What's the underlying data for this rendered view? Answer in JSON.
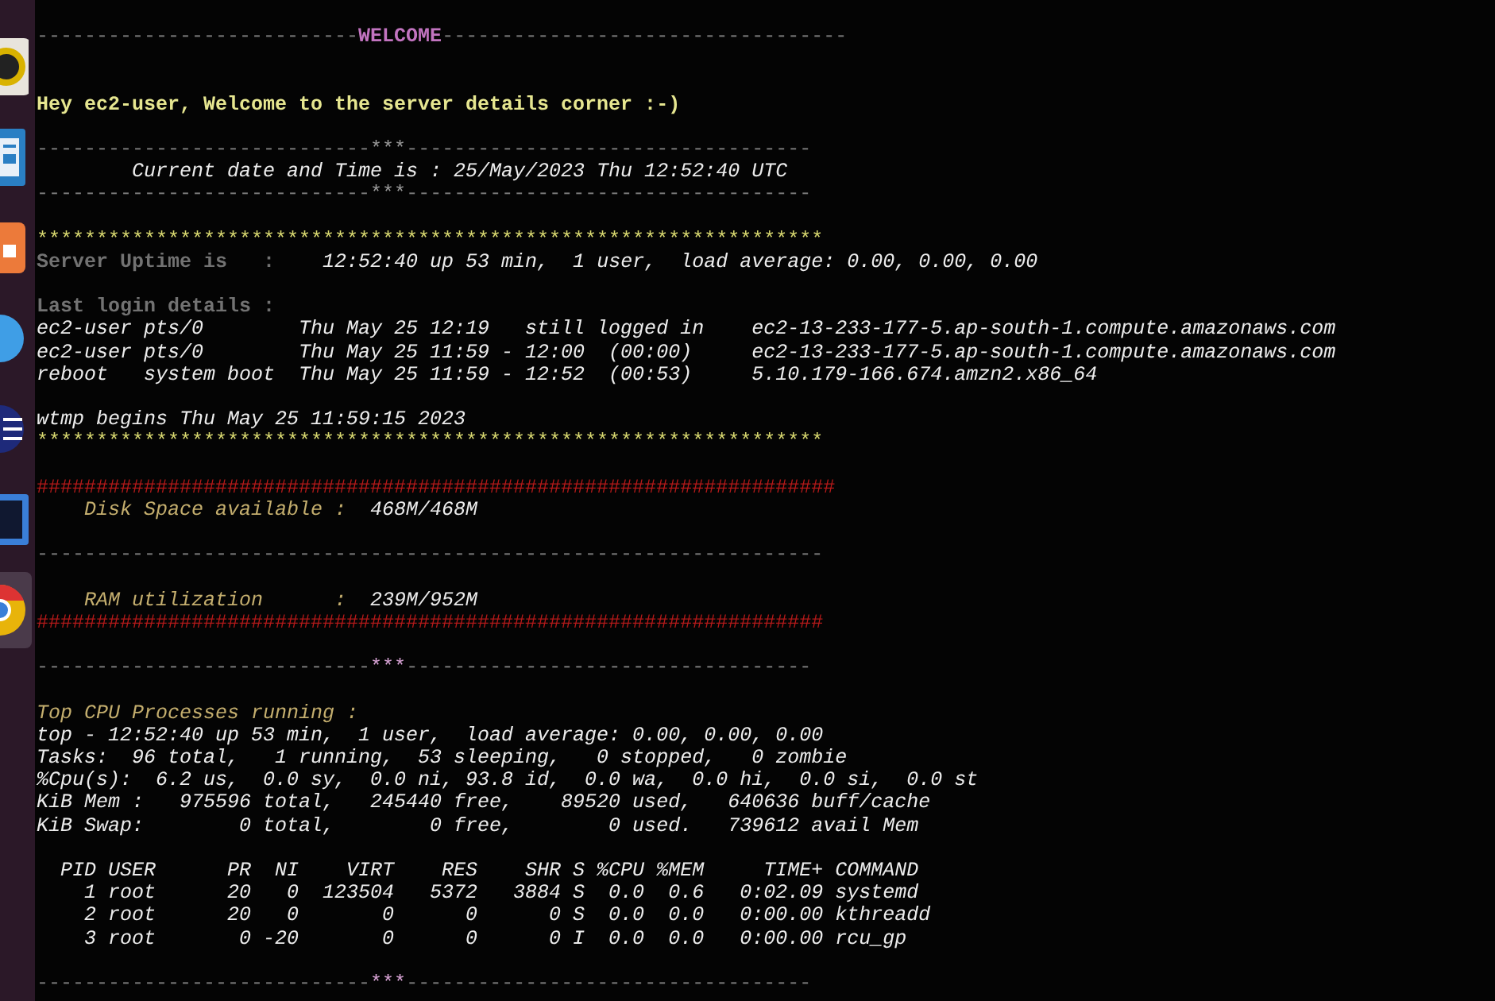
{
  "dock": {
    "items": [
      {
        "kind": "disc",
        "selected": false
      },
      {
        "kind": "document",
        "selected": false
      },
      {
        "kind": "tile",
        "selected": false
      },
      {
        "kind": "sphere",
        "selected": false
      },
      {
        "kind": "lines",
        "selected": false
      },
      {
        "kind": "window",
        "selected": false
      },
      {
        "kind": "browser",
        "selected": true
      }
    ]
  },
  "terminal": {
    "lines": [
      {
        "kind": "text",
        "spans": [
          {
            "text": "---------------------------",
            "kind": "dash"
          },
          {
            "text": "WELCOME",
            "kind": "magenta"
          },
          {
            "text": "----------------------------------",
            "kind": "dash"
          }
        ]
      },
      {
        "kind": "blank"
      },
      {
        "kind": "blank"
      },
      {
        "kind": "text",
        "spans": [
          {
            "text": "Hey ec2-user, Welcome to the server details corner :-)",
            "kind": "yellow"
          }
        ]
      },
      {
        "kind": "blank"
      },
      {
        "kind": "text",
        "spans": [
          {
            "text": "----------------------------",
            "kind": "dash"
          },
          {
            "text": "***",
            "kind": "dim"
          },
          {
            "text": "----------------------------------",
            "kind": "dash"
          }
        ]
      },
      {
        "kind": "text",
        "spans": [
          {
            "text": "        Current date and Time is : 25/May/2023 Thu 12:52:40 UTC",
            "kind": "white"
          }
        ]
      },
      {
        "kind": "text",
        "spans": [
          {
            "text": "----------------------------",
            "kind": "dash"
          },
          {
            "text": "***",
            "kind": "dim"
          },
          {
            "text": "----------------------------------",
            "kind": "dash"
          }
        ]
      },
      {
        "kind": "blank"
      },
      {
        "kind": "text",
        "spans": [
          {
            "text": "******************************************************************",
            "kind": "stars"
          }
        ]
      },
      {
        "kind": "text",
        "spans": [
          {
            "text": "Server Uptime is   :",
            "kind": "gray"
          },
          {
            "text": "    12:52:40 up 53 min,  1 user,  load average: 0.00, 0.00, 0.00",
            "kind": "white"
          }
        ]
      },
      {
        "kind": "blank"
      },
      {
        "kind": "text",
        "spans": [
          {
            "text": "Last login details :",
            "kind": "gray"
          }
        ]
      },
      {
        "kind": "text",
        "spans": [
          {
            "text": "ec2-user pts/0        Thu May 25 12:19   still logged in    ec2-13-233-177-5.ap-south-1.compute.amazonaws.com",
            "kind": "white"
          }
        ]
      },
      {
        "kind": "text",
        "spans": [
          {
            "text": "ec2-user pts/0        Thu May 25 11:59 - 12:00  (00:00)     ec2-13-233-177-5.ap-south-1.compute.amazonaws.com",
            "kind": "white"
          }
        ]
      },
      {
        "kind": "text",
        "spans": [
          {
            "text": "reboot   system boot  Thu May 25 11:59 - 12:52  (00:53)     5.10.179-166.674.amzn2.x86_64",
            "kind": "white"
          }
        ]
      },
      {
        "kind": "blank"
      },
      {
        "kind": "text",
        "spans": [
          {
            "text": "wtmp begins Thu May 25 11:59:15 2023",
            "kind": "white"
          }
        ]
      },
      {
        "kind": "text",
        "spans": [
          {
            "text": "******************************************************************",
            "kind": "stars"
          }
        ]
      },
      {
        "kind": "blank"
      },
      {
        "kind": "text",
        "spans": [
          {
            "text": "###################################################################",
            "kind": "red"
          }
        ]
      },
      {
        "kind": "text",
        "spans": [
          {
            "text": "    Disk Space available :",
            "kind": "gold"
          },
          {
            "text": "  468M/468M",
            "kind": "white"
          }
        ]
      },
      {
        "kind": "blank"
      },
      {
        "kind": "text",
        "spans": [
          {
            "text": "------------------------------------------------------------------",
            "kind": "dash"
          }
        ]
      },
      {
        "kind": "blank"
      },
      {
        "kind": "text",
        "spans": [
          {
            "text": "    RAM utilization      :",
            "kind": "gold"
          },
          {
            "text": "  239M/952M",
            "kind": "white"
          }
        ]
      },
      {
        "kind": "text",
        "spans": [
          {
            "text": "##################################################################",
            "kind": "red"
          }
        ]
      },
      {
        "kind": "blank"
      },
      {
        "kind": "text",
        "spans": [
          {
            "text": "----------------------------",
            "kind": "dash"
          },
          {
            "text": "***",
            "kind": "pink"
          },
          {
            "text": "----------------------------------",
            "kind": "dash"
          }
        ]
      },
      {
        "kind": "blank"
      },
      {
        "kind": "text",
        "spans": [
          {
            "text": "Top CPU Processes running :",
            "kind": "gold"
          }
        ]
      },
      {
        "kind": "text",
        "spans": [
          {
            "text": "top - 12:52:40 up 53 min,  1 user,  load average: 0.00, 0.00, 0.00",
            "kind": "white"
          }
        ]
      },
      {
        "kind": "text",
        "spans": [
          {
            "text": "Tasks:  96 total,   1 running,  53 sleeping,   0 stopped,   0 zombie",
            "kind": "white"
          }
        ]
      },
      {
        "kind": "text",
        "spans": [
          {
            "text": "%Cpu(s):  6.2 us,  0.0 sy,  0.0 ni, 93.8 id,  0.0 wa,  0.0 hi,  0.0 si,  0.0 st",
            "kind": "white"
          }
        ]
      },
      {
        "kind": "text",
        "spans": [
          {
            "text": "KiB Mem :   975596 total,   245440 free,    89520 used,   640636 buff/cache",
            "kind": "white"
          }
        ]
      },
      {
        "kind": "text",
        "spans": [
          {
            "text": "KiB Swap:        0 total,        0 free,        0 used.   739612 avail Mem",
            "kind": "white"
          }
        ]
      },
      {
        "kind": "blank"
      },
      {
        "kind": "text",
        "spans": [
          {
            "text": "  PID USER      PR  NI    VIRT    RES    SHR S %CPU %MEM     TIME+ COMMAND",
            "kind": "white"
          }
        ]
      },
      {
        "kind": "text",
        "spans": [
          {
            "text": "    1 root      20   0  123504   5372   3884 S  0.0  0.6   0:02.09 systemd",
            "kind": "white"
          }
        ]
      },
      {
        "kind": "text",
        "spans": [
          {
            "text": "    2 root      20   0       0      0      0 S  0.0  0.0   0:00.00 kthreadd",
            "kind": "white"
          }
        ]
      },
      {
        "kind": "text",
        "spans": [
          {
            "text": "    3 root       0 -20       0      0      0 I  0.0  0.0   0:00.00 rcu_gp",
            "kind": "white"
          }
        ]
      },
      {
        "kind": "blank"
      },
      {
        "kind": "text",
        "spans": [
          {
            "text": "----------------------------",
            "kind": "dash"
          },
          {
            "text": "***",
            "kind": "pink"
          },
          {
            "text": "----------------------------------",
            "kind": "dash"
          }
        ]
      }
    ]
  }
}
